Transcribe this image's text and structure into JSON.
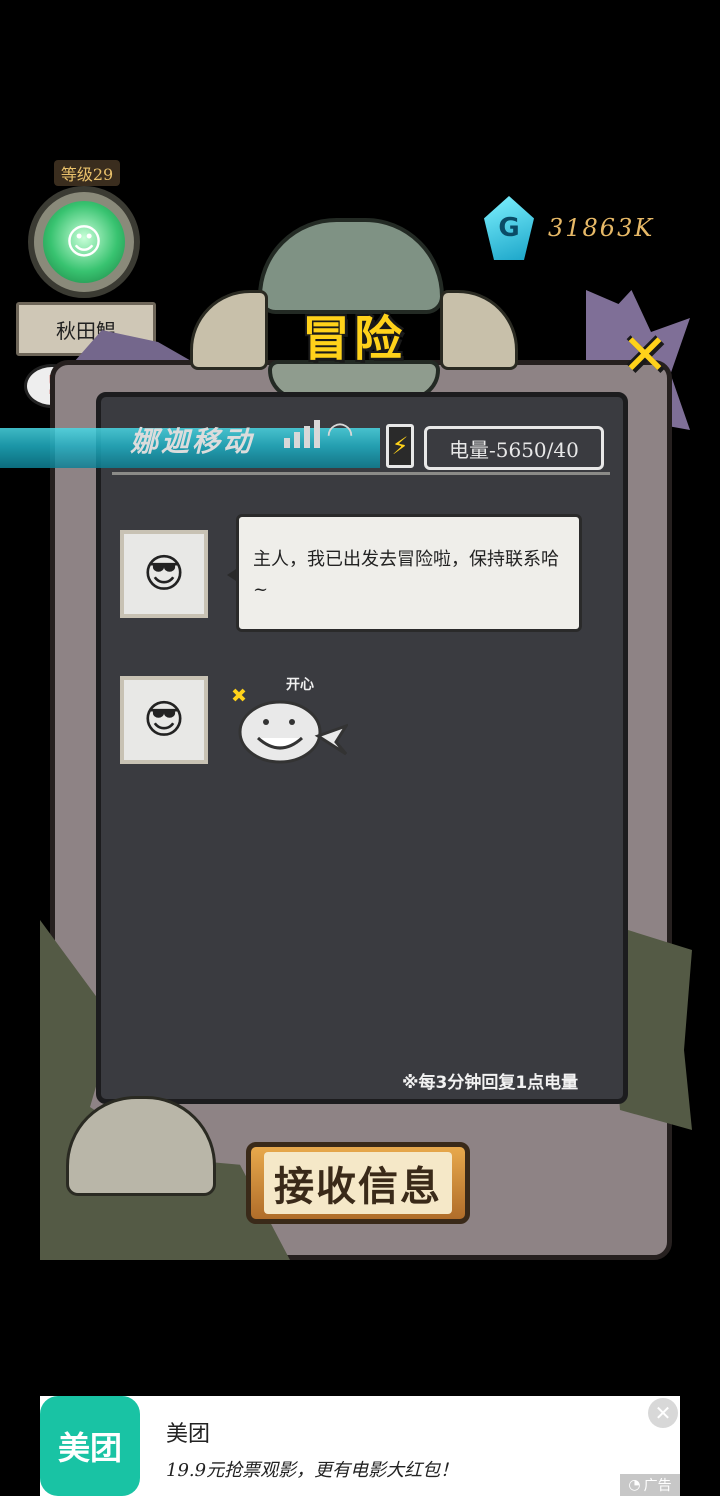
{
  "player": {
    "level_label": "等级29",
    "name": "秋田鰛",
    "alert_icon": "exclamation-bubble-icon"
  },
  "currency": {
    "icon": "g-gem-icon",
    "value": "31863K"
  },
  "header": {
    "title": "冒险",
    "close_icon": "close-x-icon"
  },
  "status_bar": {
    "carrier": "娜迦移动",
    "signal_icon": "signal-bars-icon",
    "wifi_icon": "wifi-icon",
    "battery_icon": "battery-charging-icon",
    "energy_label": "电量-5650/40"
  },
  "messages": [
    {
      "type": "text",
      "avatar": "sunglasses-fish-avatar",
      "text": "主人，我已出发去冒险啦，保持联系哈~"
    },
    {
      "type": "sticker",
      "avatar": "sunglasses-fish-avatar",
      "sticker_label": "开心"
    }
  ],
  "regen_note": "※每3分钟回复1点电量",
  "receive_button": {
    "label": "接收信息"
  },
  "ad": {
    "logo_text": "美团",
    "title": "美团",
    "description": "19.9元抢票观影，更有电影大红包！",
    "tag": "广告",
    "close_icon": "close-icon"
  },
  "colors": {
    "accent_yellow": "#ffd21a",
    "currency_gold": "#e7b967",
    "ad_brand": "#19c3a4",
    "frame": "#8e8385",
    "screen": "#3a3b40"
  }
}
